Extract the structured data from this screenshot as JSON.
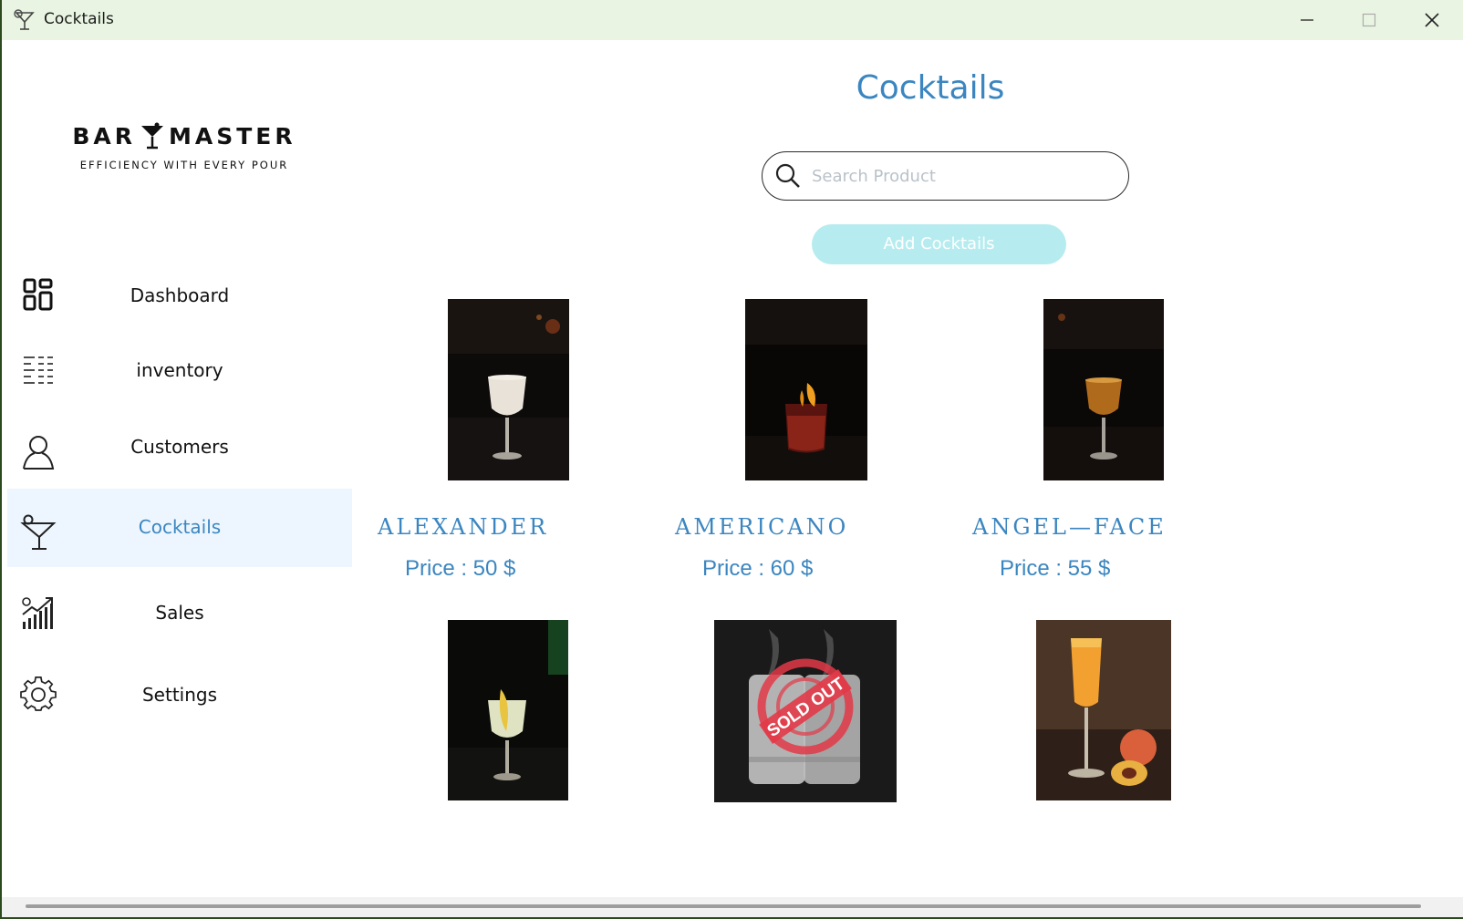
{
  "window": {
    "title": "Cocktails",
    "icons": {
      "app": "cocktail-glass-icon",
      "minimize": "minimize-icon",
      "maximize": "maximize-icon",
      "close": "close-icon"
    }
  },
  "logo": {
    "title_left": "BAR",
    "title_right": "MASTER",
    "tagline": "EFFICIENCY WITH EVERY POUR"
  },
  "sidebar": {
    "items": [
      {
        "label": "Dashboard",
        "icon": "dashboard-grid-icon",
        "active": false
      },
      {
        "label": "inventory",
        "icon": "list-icon",
        "active": false
      },
      {
        "label": "Customers",
        "icon": "user-icon",
        "active": false
      },
      {
        "label": "Cocktails",
        "icon": "cocktail-glass-icon",
        "active": true
      },
      {
        "label": "Sales",
        "icon": "sales-chart-icon",
        "active": false
      },
      {
        "label": "Settings",
        "icon": "gear-icon",
        "active": false
      }
    ]
  },
  "main": {
    "title": "Cocktails",
    "search": {
      "placeholder": "Search Product",
      "value": ""
    },
    "add_button": "Add Cocktails",
    "cocktails": [
      {
        "name": "ALEXANDER",
        "price": "Price : 50 $",
        "image": "white-cocktail-coupe-photo"
      },
      {
        "name": "AMERICANO",
        "price": "Price : 60 $",
        "image": "red-cocktail-rocks-glass-photo"
      },
      {
        "name": "ANGEL—FACE",
        "price": "Price : 55 $",
        "image": "amber-cocktail-coupe-photo"
      },
      {
        "image": "lemon-cocktail-coupe-photo"
      },
      {
        "image": "smoky-shot-glasses-photo",
        "badge": "SOLD OUT"
      },
      {
        "image": "peach-bellini-flute-photo"
      }
    ]
  },
  "colors": {
    "accent": "#3b86c0",
    "titlebar": "#e9f5e2",
    "active_nav_bg": "#edf6fe",
    "add_button_bg": "#b6ecef",
    "sold_out": "#e23a48"
  }
}
